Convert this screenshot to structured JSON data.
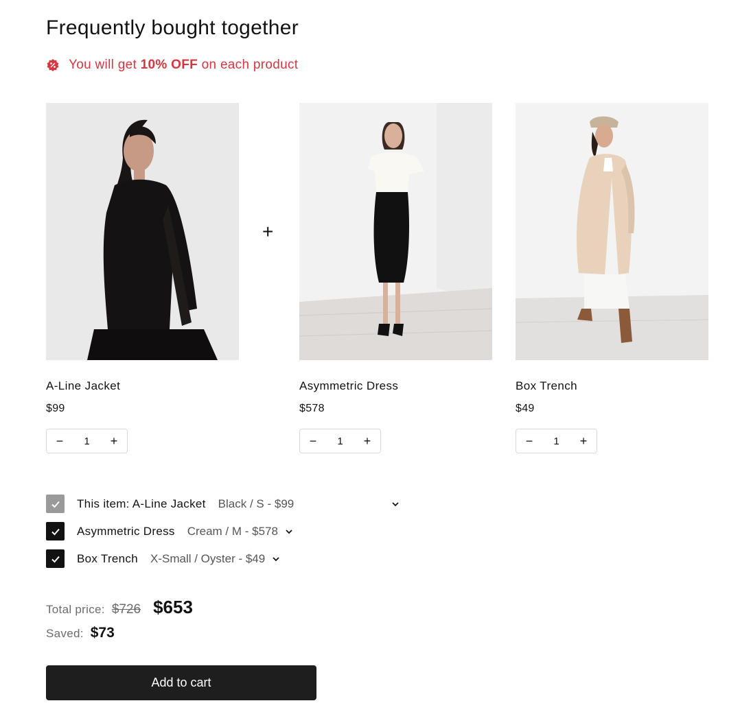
{
  "section": {
    "title": "Frequently bought together",
    "promo_prefix": "You will get",
    "promo_highlight": "10% OFF",
    "promo_suffix": "on each product",
    "plus_sign": "+"
  },
  "products": [
    {
      "name": "A-Line Jacket",
      "price": "$99",
      "qty": "1"
    },
    {
      "name": "Asymmetric Dress",
      "price": "$578",
      "qty": "1"
    },
    {
      "name": "Box Trench",
      "price": "$49",
      "qty": "1"
    }
  ],
  "options": [
    {
      "label": "This item: A-Line Jacket",
      "variant": "Black / S - $99",
      "checked": true,
      "disabled": true
    },
    {
      "label": "Asymmetric Dress",
      "variant": "Cream / M - $578",
      "checked": true,
      "disabled": false
    },
    {
      "label": "Box Trench",
      "variant": "X-Small / Oyster - $49",
      "checked": true,
      "disabled": false
    }
  ],
  "totals": {
    "total_label": "Total price:",
    "old_price": "$726",
    "new_price": "$653",
    "saved_label": "Saved:",
    "saved_value": "$73"
  },
  "cart_button": "Add to cart",
  "icons": {
    "qty_minus": "−",
    "qty_plus": "+"
  },
  "colors": {
    "promo": "#d4373f",
    "button_bg": "#1e1e1e",
    "checkbox": "#121212",
    "checkbox_disabled": "#9a9a9a"
  }
}
